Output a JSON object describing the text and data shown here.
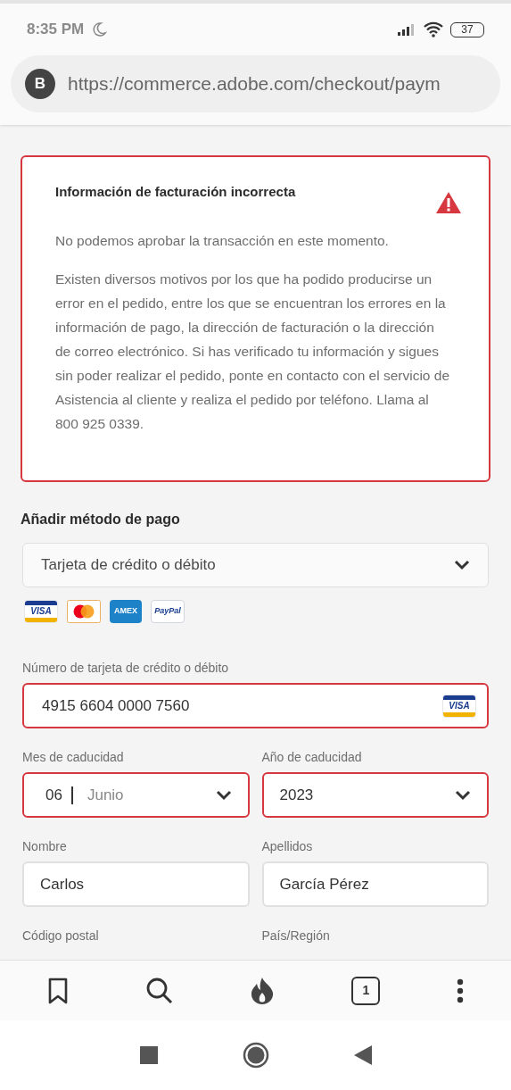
{
  "status_bar": {
    "time": "8:35 PM",
    "battery": "37"
  },
  "address_bar": {
    "site_letter": "B",
    "url": "https://commerce.adobe.com/checkout/paym"
  },
  "alert": {
    "title": "Información de facturación incorrecta",
    "paragraphs": [
      "No podemos aprobar la transacción en este momento.",
      "Existen diversos motivos por los que ha podido producirse un error en el pedido, entre los que se encuentran los errores en la información de pago, la dirección de facturación o la dirección de correo electrónico. Si has verificado tu información y sigues sin poder realizar el pedido, ponte en contacto con el servicio de Asistencia al cliente y realiza el pedido por teléfono. Llama al 800 925 0339."
    ]
  },
  "payment": {
    "heading": "Añadir método de pago",
    "method": "Tarjeta de crédito o débito",
    "card_logos": [
      {
        "kind": "visa",
        "label": "VISA"
      },
      {
        "kind": "mastercard"
      },
      {
        "kind": "amex",
        "label": "AMEX"
      },
      {
        "kind": "paypal",
        "label": "PayPal"
      }
    ],
    "card_number": {
      "label": "Número de tarjeta de crédito o débito",
      "value": "4915 6604 0000 7560",
      "error": true,
      "brand_label": "VISA"
    },
    "rows": [
      [
        {
          "kind": "month",
          "label": "Mes de caducidad",
          "value": "06",
          "extra": "Junio",
          "error": true
        },
        {
          "kind": "select",
          "label": "Año de caducidad",
          "value": "2023",
          "error": true
        }
      ],
      [
        {
          "kind": "text",
          "label": "Nombre",
          "value": "Carlos",
          "error": false
        },
        {
          "kind": "text",
          "label": "Apellidos",
          "value": "García Pérez",
          "error": false
        }
      ],
      [
        {
          "kind": "label",
          "label": "Código postal"
        },
        {
          "kind": "label",
          "label": "País/Región"
        }
      ]
    ]
  },
  "toolbar": {
    "tab_count": "1"
  }
}
